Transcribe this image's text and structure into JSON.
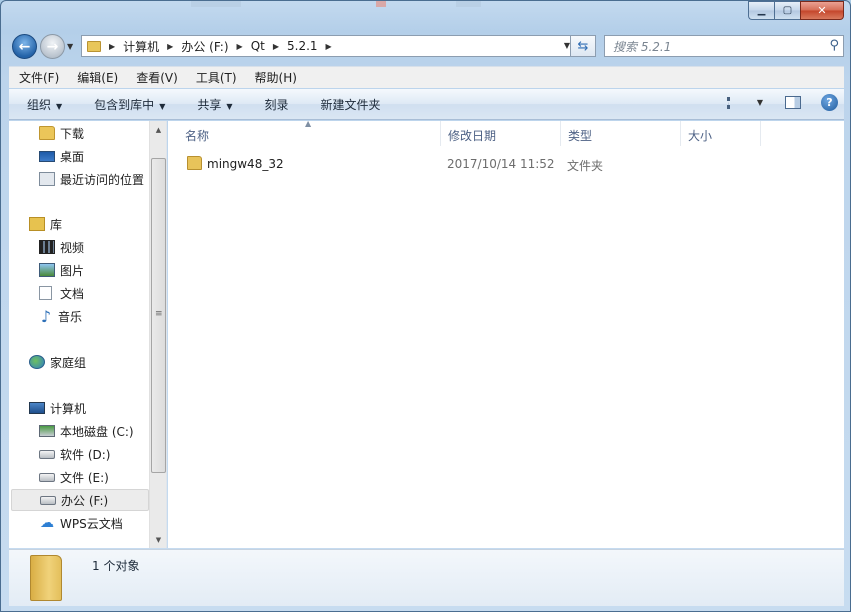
{
  "window": {
    "caption": {
      "minimize": "▁",
      "maximize": "▢",
      "close": "✕"
    }
  },
  "navigation": {
    "breadcrumb": [
      "计算机",
      "办公 (F:)",
      "Qt",
      "5.2.1"
    ],
    "search_placeholder": "搜索 5.2.1"
  },
  "menubar": {
    "items": [
      "文件(F)",
      "编辑(E)",
      "查看(V)",
      "工具(T)",
      "帮助(H)"
    ]
  },
  "toolbar": {
    "organize": "组织",
    "include_in_library": "包含到库中",
    "share": "共享",
    "burn": "刻录",
    "new_folder": "新建文件夹"
  },
  "sidebar": {
    "items": [
      {
        "label": "下载",
        "icon": "folder-icon"
      },
      {
        "label": "桌面",
        "icon": "desktop-icon"
      },
      {
        "label": "最近访问的位置",
        "icon": "recent-places-icon"
      },
      {
        "label": "库",
        "icon": "library-icon"
      },
      {
        "label": "视频",
        "icon": "video-icon"
      },
      {
        "label": "图片",
        "icon": "picture-icon"
      },
      {
        "label": "文档",
        "icon": "document-icon"
      },
      {
        "label": "音乐",
        "icon": "music-icon"
      },
      {
        "label": "家庭组",
        "icon": "homegroup-icon"
      },
      {
        "label": "计算机",
        "icon": "computer-icon"
      },
      {
        "label": "本地磁盘 (C:)",
        "icon": "local-disk-icon"
      },
      {
        "label": "软件 (D:)",
        "icon": "drive-icon"
      },
      {
        "label": "文件 (E:)",
        "icon": "drive-icon"
      },
      {
        "label": "办公 (F:)",
        "icon": "drive-icon",
        "selected": true
      },
      {
        "label": "WPS云文档",
        "icon": "cloud-icon"
      }
    ]
  },
  "file_list": {
    "columns": [
      "名称",
      "修改日期",
      "类型",
      "大小"
    ],
    "rows": [
      {
        "name": "mingw48_32",
        "modified": "2017/10/14 11:52",
        "type": "文件夹",
        "size": ""
      }
    ]
  },
  "details_pane": {
    "summary": "1 个对象"
  }
}
